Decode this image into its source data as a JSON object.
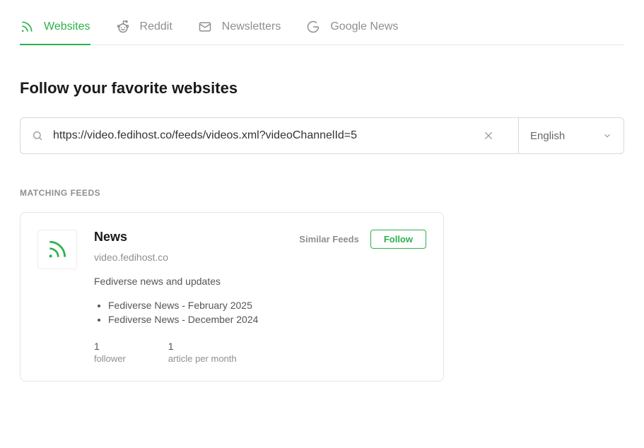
{
  "tabs": [
    {
      "label": "Websites",
      "icon": "rss"
    },
    {
      "label": "Reddit",
      "icon": "reddit"
    },
    {
      "label": "Newsletters",
      "icon": "mail"
    },
    {
      "label": "Google News",
      "icon": "google"
    }
  ],
  "heading": "Follow your favorite websites",
  "search": {
    "value": "https://video.fedihost.co/feeds/videos.xml?videoChannelId=5"
  },
  "language": "English",
  "section_label": "MATCHING FEEDS",
  "feed": {
    "title": "News",
    "domain": "video.fedihost.co",
    "description": "Fediverse news and updates",
    "similar_label": "Similar Feeds",
    "follow_label": "Follow",
    "articles": [
      "Fediverse News - February 2025",
      "Fediverse News - December 2024"
    ],
    "stats": [
      {
        "value": "1",
        "label": "follower"
      },
      {
        "value": "1",
        "label": "article per month"
      }
    ]
  }
}
